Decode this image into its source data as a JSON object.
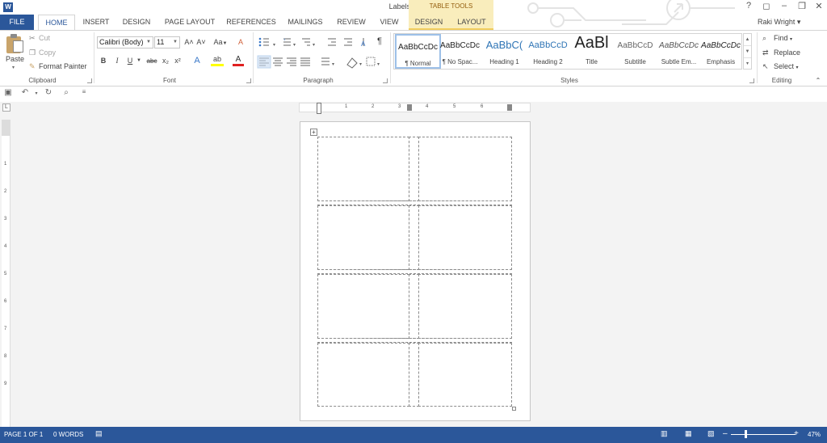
{
  "titlebar": {
    "app_icon": "W",
    "title": "Labels5 - Word",
    "help": "?",
    "ribbon_display": "◻",
    "minimize": "–",
    "restore": "❐",
    "close": "✕"
  },
  "contextual": {
    "group": "TABLE TOOLS"
  },
  "tabs": {
    "file": "FILE",
    "home": "HOME",
    "insert": "INSERT",
    "design": "DESIGN",
    "page_layout": "PAGE LAYOUT",
    "references": "REFERENCES",
    "mailings": "MAILINGS",
    "review": "REVIEW",
    "view": "VIEW",
    "table_design": "DESIGN",
    "table_layout": "LAYOUT"
  },
  "user": {
    "name": "Raki Wright",
    "caret": "▾"
  },
  "clipboard": {
    "paste": "Paste",
    "paste_arrow": "▾",
    "cut": "Cut",
    "copy": "Copy",
    "format_painter": "Format Painter",
    "label": "Clipboard"
  },
  "font": {
    "name": "Calibri (Body)",
    "size": "11",
    "grow": "A˄",
    "shrink": "A˅",
    "change_case": "Aa",
    "clear": "A",
    "bold": "B",
    "italic": "I",
    "underline": "U",
    "strike": "abc",
    "subscript": "x₂",
    "superscript": "x²",
    "text_effects": "A",
    "highlight": "ab",
    "font_color": "A",
    "label": "Font"
  },
  "paragraph": {
    "label": "Paragraph",
    "pilcrow": "¶"
  },
  "styles": {
    "label": "Styles",
    "items": [
      {
        "sample": "AaBbCcDc",
        "name": "¶ Normal"
      },
      {
        "sample": "AaBbCcDc",
        "name": "¶ No Spac..."
      },
      {
        "sample": "AaBbC(",
        "name": "Heading 1"
      },
      {
        "sample": "AaBbCcD",
        "name": "Heading 2"
      },
      {
        "sample": "AaBl",
        "name": "Title"
      },
      {
        "sample": "AaBbCcD",
        "name": "Subtitle"
      },
      {
        "sample": "AaBbCcDc",
        "name": "Subtle Em..."
      },
      {
        "sample": "AaBbCcDc",
        "name": "Emphasis"
      }
    ]
  },
  "editing": {
    "find": "Find",
    "replace": "Replace",
    "select": "Select",
    "label": "Editing"
  },
  "qat": {
    "save": "💾",
    "undo": "↶",
    "redo": "↻",
    "preview": "🔍",
    "customize": "≡"
  },
  "ruler": {
    "h_ticks": [
      "1",
      "2",
      "3",
      "4",
      "5",
      "6"
    ],
    "v_ticks": [
      "1",
      "2",
      "3",
      "4",
      "5",
      "6",
      "7",
      "8",
      "9"
    ],
    "corner": "L"
  },
  "status": {
    "page": "PAGE 1 OF 1",
    "words": "0 WORDS",
    "zoom_minus": "–",
    "zoom_plus": "+",
    "zoom": "47%",
    "zoom_level": 0.47
  },
  "colors": {
    "brand": "#2b579a",
    "table_tools": "#f9edbc",
    "selected": "#c5d9f1"
  }
}
